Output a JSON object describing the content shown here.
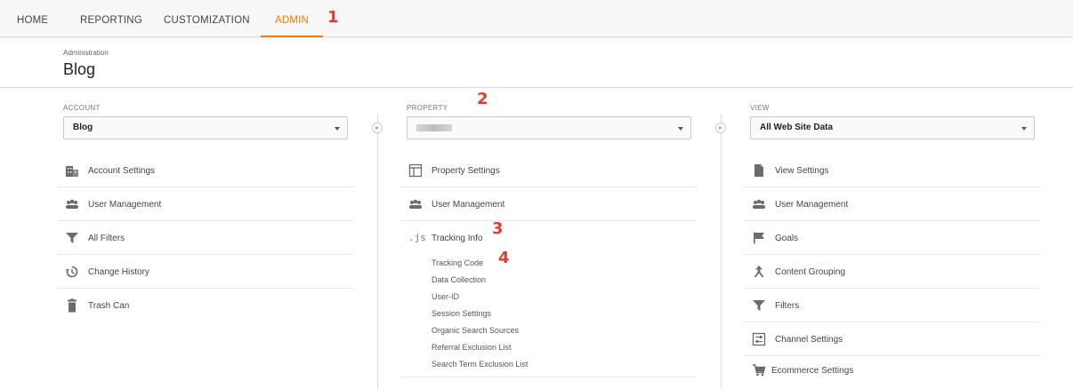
{
  "nav": {
    "tabs": [
      "HOME",
      "REPORTING",
      "CUSTOMIZATION",
      "ADMIN"
    ],
    "active": "ADMIN"
  },
  "annotations": [
    "1",
    "2",
    "3",
    "4"
  ],
  "header": {
    "breadcrumb": "Administration",
    "title": "Blog"
  },
  "account": {
    "label": "ACCOUNT",
    "selected": "Blog",
    "items": [
      "Account Settings",
      "User Management",
      "All Filters",
      "Change History",
      "Trash Can"
    ]
  },
  "property": {
    "label": "PROPERTY",
    "selected": "",
    "items": [
      "Property Settings",
      "User Management",
      "Tracking Info"
    ],
    "tracking_sub": [
      "Tracking Code",
      "Data Collection",
      "User-ID",
      "Session Settings",
      "Organic Search Sources",
      "Referral Exclusion List",
      "Search Term Exclusion List"
    ]
  },
  "view": {
    "label": "VIEW",
    "selected": "All Web Site Data",
    "items": [
      "View Settings",
      "User Management",
      "Goals",
      "Content Grouping",
      "Filters",
      "Channel Settings",
      "Ecommerce Settings"
    ]
  },
  "colors": {
    "accent": "#f57c00",
    "annotation": "#e53935"
  }
}
